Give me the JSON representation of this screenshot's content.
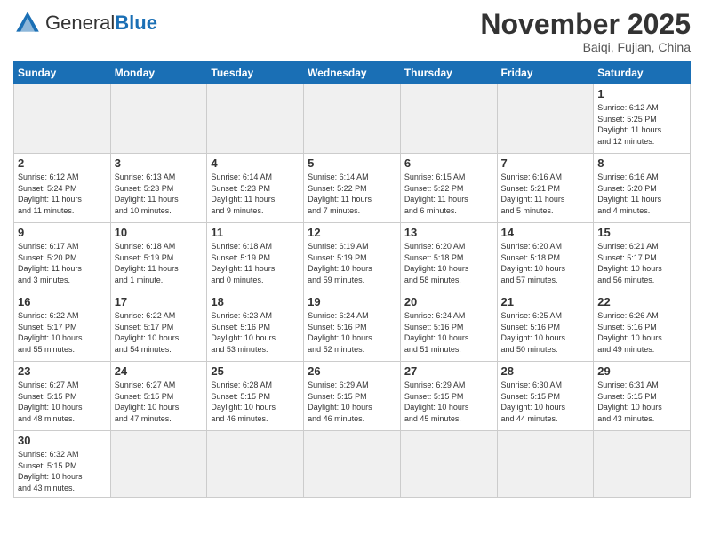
{
  "header": {
    "logo_general": "General",
    "logo_blue": "Blue",
    "month_title": "November 2025",
    "location": "Baiqi, Fujian, China"
  },
  "days_of_week": [
    "Sunday",
    "Monday",
    "Tuesday",
    "Wednesday",
    "Thursday",
    "Friday",
    "Saturday"
  ],
  "weeks": [
    [
      {
        "day": "",
        "empty": true
      },
      {
        "day": "",
        "empty": true
      },
      {
        "day": "",
        "empty": true
      },
      {
        "day": "",
        "empty": true
      },
      {
        "day": "",
        "empty": true
      },
      {
        "day": "",
        "empty": true
      },
      {
        "day": "1",
        "info": "Sunrise: 6:12 AM\nSunset: 5:25 PM\nDaylight: 11 hours\nand 12 minutes."
      }
    ],
    [
      {
        "day": "2",
        "info": "Sunrise: 6:12 AM\nSunset: 5:24 PM\nDaylight: 11 hours\nand 11 minutes."
      },
      {
        "day": "3",
        "info": "Sunrise: 6:13 AM\nSunset: 5:23 PM\nDaylight: 11 hours\nand 10 minutes."
      },
      {
        "day": "4",
        "info": "Sunrise: 6:14 AM\nSunset: 5:23 PM\nDaylight: 11 hours\nand 9 minutes."
      },
      {
        "day": "5",
        "info": "Sunrise: 6:14 AM\nSunset: 5:22 PM\nDaylight: 11 hours\nand 7 minutes."
      },
      {
        "day": "6",
        "info": "Sunrise: 6:15 AM\nSunset: 5:22 PM\nDaylight: 11 hours\nand 6 minutes."
      },
      {
        "day": "7",
        "info": "Sunrise: 6:16 AM\nSunset: 5:21 PM\nDaylight: 11 hours\nand 5 minutes."
      },
      {
        "day": "8",
        "info": "Sunrise: 6:16 AM\nSunset: 5:20 PM\nDaylight: 11 hours\nand 4 minutes."
      }
    ],
    [
      {
        "day": "9",
        "info": "Sunrise: 6:17 AM\nSunset: 5:20 PM\nDaylight: 11 hours\nand 3 minutes."
      },
      {
        "day": "10",
        "info": "Sunrise: 6:18 AM\nSunset: 5:19 PM\nDaylight: 11 hours\nand 1 minute."
      },
      {
        "day": "11",
        "info": "Sunrise: 6:18 AM\nSunset: 5:19 PM\nDaylight: 11 hours\nand 0 minutes."
      },
      {
        "day": "12",
        "info": "Sunrise: 6:19 AM\nSunset: 5:19 PM\nDaylight: 10 hours\nand 59 minutes."
      },
      {
        "day": "13",
        "info": "Sunrise: 6:20 AM\nSunset: 5:18 PM\nDaylight: 10 hours\nand 58 minutes."
      },
      {
        "day": "14",
        "info": "Sunrise: 6:20 AM\nSunset: 5:18 PM\nDaylight: 10 hours\nand 57 minutes."
      },
      {
        "day": "15",
        "info": "Sunrise: 6:21 AM\nSunset: 5:17 PM\nDaylight: 10 hours\nand 56 minutes."
      }
    ],
    [
      {
        "day": "16",
        "info": "Sunrise: 6:22 AM\nSunset: 5:17 PM\nDaylight: 10 hours\nand 55 minutes."
      },
      {
        "day": "17",
        "info": "Sunrise: 6:22 AM\nSunset: 5:17 PM\nDaylight: 10 hours\nand 54 minutes."
      },
      {
        "day": "18",
        "info": "Sunrise: 6:23 AM\nSunset: 5:16 PM\nDaylight: 10 hours\nand 53 minutes."
      },
      {
        "day": "19",
        "info": "Sunrise: 6:24 AM\nSunset: 5:16 PM\nDaylight: 10 hours\nand 52 minutes."
      },
      {
        "day": "20",
        "info": "Sunrise: 6:24 AM\nSunset: 5:16 PM\nDaylight: 10 hours\nand 51 minutes."
      },
      {
        "day": "21",
        "info": "Sunrise: 6:25 AM\nSunset: 5:16 PM\nDaylight: 10 hours\nand 50 minutes."
      },
      {
        "day": "22",
        "info": "Sunrise: 6:26 AM\nSunset: 5:16 PM\nDaylight: 10 hours\nand 49 minutes."
      }
    ],
    [
      {
        "day": "23",
        "info": "Sunrise: 6:27 AM\nSunset: 5:15 PM\nDaylight: 10 hours\nand 48 minutes."
      },
      {
        "day": "24",
        "info": "Sunrise: 6:27 AM\nSunset: 5:15 PM\nDaylight: 10 hours\nand 47 minutes."
      },
      {
        "day": "25",
        "info": "Sunrise: 6:28 AM\nSunset: 5:15 PM\nDaylight: 10 hours\nand 46 minutes."
      },
      {
        "day": "26",
        "info": "Sunrise: 6:29 AM\nSunset: 5:15 PM\nDaylight: 10 hours\nand 46 minutes."
      },
      {
        "day": "27",
        "info": "Sunrise: 6:29 AM\nSunset: 5:15 PM\nDaylight: 10 hours\nand 45 minutes."
      },
      {
        "day": "28",
        "info": "Sunrise: 6:30 AM\nSunset: 5:15 PM\nDaylight: 10 hours\nand 44 minutes."
      },
      {
        "day": "29",
        "info": "Sunrise: 6:31 AM\nSunset: 5:15 PM\nDaylight: 10 hours\nand 43 minutes."
      }
    ],
    [
      {
        "day": "30",
        "info": "Sunrise: 6:32 AM\nSunset: 5:15 PM\nDaylight: 10 hours\nand 43 minutes."
      },
      {
        "day": "",
        "empty": true
      },
      {
        "day": "",
        "empty": true
      },
      {
        "day": "",
        "empty": true
      },
      {
        "day": "",
        "empty": true
      },
      {
        "day": "",
        "empty": true
      },
      {
        "day": "",
        "empty": true
      }
    ]
  ]
}
